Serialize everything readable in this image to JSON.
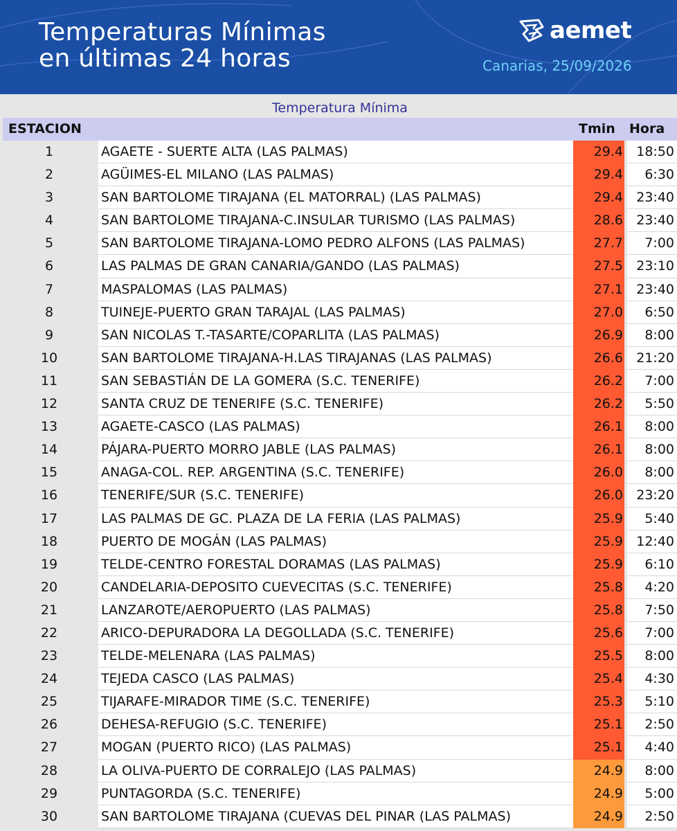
{
  "header": {
    "title_line1": "Temperaturas Mínimas",
    "title_line2": "en últimas 24 horas",
    "brand": "aemet",
    "region_date": "Canarias, 25/09/2026"
  },
  "table": {
    "caption": "Temperatura Mínima",
    "columns": {
      "station": "ESTACION",
      "tmin": "Tmin",
      "hora": "Hora"
    },
    "rows": [
      {
        "n": "1",
        "station": "AGAETE - SUERTE ALTA (LAS PALMAS)",
        "tmin": "29.4",
        "hora": "18:50",
        "color": "#ff5a32"
      },
      {
        "n": "2",
        "station": "AGÜIMES-EL MILANO (LAS PALMAS)",
        "tmin": "29.4",
        "hora": "6:30",
        "color": "#ff5a32"
      },
      {
        "n": "3",
        "station": "SAN BARTOLOME TIRAJANA (EL MATORRAL) (LAS PALMAS)",
        "tmin": "29.4",
        "hora": "23:40",
        "color": "#ff5a32"
      },
      {
        "n": "4",
        "station": "SAN BARTOLOME TIRAJANA-C.INSULAR TURISMO (LAS PALMAS)",
        "tmin": "28.6",
        "hora": "23:40",
        "color": "#ff5a32"
      },
      {
        "n": "5",
        "station": "SAN BARTOLOME TIRAJANA-LOMO PEDRO ALFONS (LAS PALMAS)",
        "tmin": "27.7",
        "hora": "7:00",
        "color": "#ff5a32"
      },
      {
        "n": "6",
        "station": "LAS PALMAS DE GRAN CANARIA/GANDO (LAS PALMAS)",
        "tmin": "27.5",
        "hora": "23:10",
        "color": "#ff5a32"
      },
      {
        "n": "7",
        "station": "MASPALOMAS (LAS PALMAS)",
        "tmin": "27.1",
        "hora": "23:40",
        "color": "#ff5a32"
      },
      {
        "n": "8",
        "station": "TUINEJE-PUERTO GRAN TARAJAL (LAS PALMAS)",
        "tmin": "27.0",
        "hora": "6:50",
        "color": "#ff5a32"
      },
      {
        "n": "9",
        "station": "SAN NICOLAS T.-TASARTE/COPARLITA (LAS PALMAS)",
        "tmin": "26.9",
        "hora": "8:00",
        "color": "#ff5a32"
      },
      {
        "n": "10",
        "station": "SAN BARTOLOME TIRAJANA-H.LAS TIRAJANAS (LAS PALMAS)",
        "tmin": "26.6",
        "hora": "21:20",
        "color": "#ff5a32"
      },
      {
        "n": "11",
        "station": "SAN SEBASTIÁN DE LA GOMERA (S.C. TENERIFE)",
        "tmin": "26.2",
        "hora": "7:00",
        "color": "#ff5a32"
      },
      {
        "n": "12",
        "station": "SANTA CRUZ DE TENERIFE (S.C. TENERIFE)",
        "tmin": "26.2",
        "hora": "5:50",
        "color": "#ff5a32"
      },
      {
        "n": "13",
        "station": "AGAETE-CASCO (LAS PALMAS)",
        "tmin": "26.1",
        "hora": "8:00",
        "color": "#ff5a32"
      },
      {
        "n": "14",
        "station": "PÁJARA-PUERTO MORRO JABLE (LAS PALMAS)",
        "tmin": "26.1",
        "hora": "8:00",
        "color": "#ff5a32"
      },
      {
        "n": "15",
        "station": "ANAGA-COL. REP. ARGENTINA (S.C. TENERIFE)",
        "tmin": "26.0",
        "hora": "8:00",
        "color": "#ff5a32"
      },
      {
        "n": "16",
        "station": "TENERIFE/SUR (S.C. TENERIFE)",
        "tmin": "26.0",
        "hora": "23:20",
        "color": "#ff5a32"
      },
      {
        "n": "17",
        "station": "LAS PALMAS DE GC. PLAZA DE LA FERIA (LAS PALMAS)",
        "tmin": "25.9",
        "hora": "5:40",
        "color": "#ff5a32"
      },
      {
        "n": "18",
        "station": "PUERTO DE MOGÁN (LAS PALMAS)",
        "tmin": "25.9",
        "hora": "12:40",
        "color": "#ff5a32"
      },
      {
        "n": "19",
        "station": "TELDE-CENTRO FORESTAL DORAMAS (LAS PALMAS)",
        "tmin": "25.9",
        "hora": "6:10",
        "color": "#ff5a32"
      },
      {
        "n": "20",
        "station": "CANDELARIA-DEPOSITO CUEVECITAS (S.C. TENERIFE)",
        "tmin": "25.8",
        "hora": "4:20",
        "color": "#ff5a32"
      },
      {
        "n": "21",
        "station": "LANZAROTE/AEROPUERTO (LAS PALMAS)",
        "tmin": "25.8",
        "hora": "7:50",
        "color": "#ff5a32"
      },
      {
        "n": "22",
        "station": "ARICO-DEPURADORA LA DEGOLLADA (S.C. TENERIFE)",
        "tmin": "25.6",
        "hora": "7:00",
        "color": "#ff5a32"
      },
      {
        "n": "23",
        "station": "TELDE-MELENARA (LAS PALMAS)",
        "tmin": "25.5",
        "hora": "8:00",
        "color": "#ff5a32"
      },
      {
        "n": "24",
        "station": "TEJEDA CASCO (LAS PALMAS)",
        "tmin": "25.4",
        "hora": "4:30",
        "color": "#ff5a32"
      },
      {
        "n": "25",
        "station": "TIJARAFE-MIRADOR TIME (S.C. TENERIFE)",
        "tmin": "25.3",
        "hora": "5:10",
        "color": "#ff5a32"
      },
      {
        "n": "26",
        "station": "DEHESA-REFUGIO (S.C. TENERIFE)",
        "tmin": "25.1",
        "hora": "2:50",
        "color": "#ff5a32"
      },
      {
        "n": "27",
        "station": "MOGAN (PUERTO RICO) (LAS PALMAS)",
        "tmin": "25.1",
        "hora": "4:40",
        "color": "#ff5a32"
      },
      {
        "n": "28",
        "station": "LA OLIVA-PUERTO DE CORRALEJO (LAS PALMAS)",
        "tmin": "24.9",
        "hora": "8:00",
        "color": "#ff9a3c"
      },
      {
        "n": "29",
        "station": "PUNTAGORDA (S.C. TENERIFE)",
        "tmin": "24.9",
        "hora": "5:00",
        "color": "#ff9a3c"
      },
      {
        "n": "30",
        "station": "SAN BARTOLOME TIRAJANA (CUEVAS DEL PINAR (LAS PALMAS)",
        "tmin": "24.9",
        "hora": "2:50",
        "color": "#ff9a3c"
      }
    ]
  }
}
